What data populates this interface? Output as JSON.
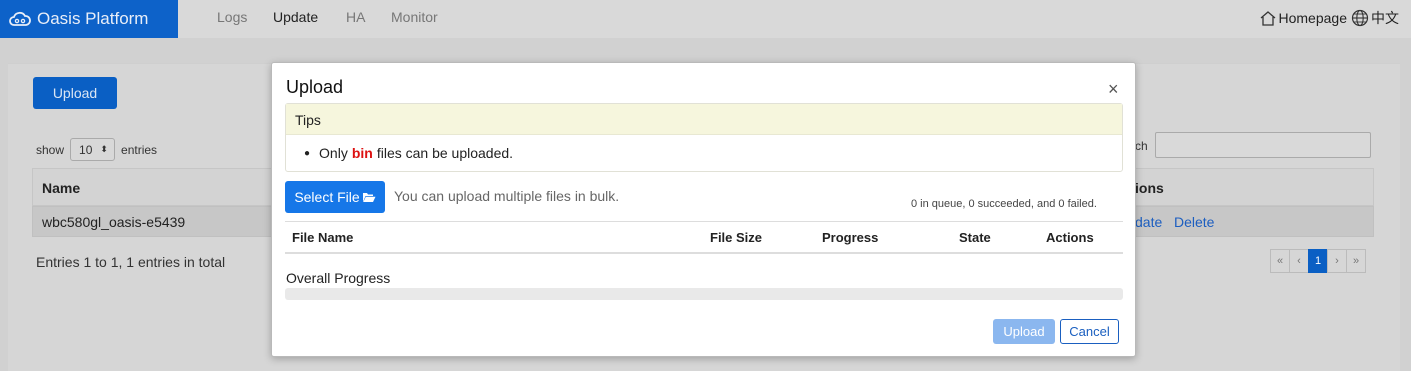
{
  "navbar": {
    "brand": "Oasis Platform",
    "items": [
      "Logs",
      "Update",
      "HA",
      "Monitor"
    ],
    "active_item": "Update",
    "homepage_label": "Homepage",
    "language_label": "中文"
  },
  "page": {
    "upload_button": "Upload",
    "show_label": "show",
    "page_size": "10",
    "entries_label": "entries",
    "search_label_partial": "ch",
    "search_value": "",
    "columns": {
      "name": "Name",
      "actions": "ions"
    },
    "rows": [
      {
        "name": "wbc580gl_oasis-e5439",
        "actions": [
          "date",
          "Delete"
        ]
      }
    ],
    "footer": "Entries 1 to 1, 1 entries in total",
    "pagination": [
      "«",
      "‹",
      "1",
      "›",
      "»"
    ],
    "current_page": "1"
  },
  "modal": {
    "title": "Upload",
    "close_symbol": "×",
    "tips": {
      "heading": "Tips",
      "text_before": "Only",
      "highlight": "bin",
      "text_after": "files can be uploaded."
    },
    "select_file_button": "Select File",
    "hint": "You can upload multiple files in bulk.",
    "queue_status": "0 in queue, 0 succeeded, and 0 failed.",
    "table_columns": [
      "File Name",
      "File Size",
      "Progress",
      "State",
      "Actions"
    ],
    "overall_progress_label": "Overall Progress",
    "overall_progress_value": 0,
    "upload_button": "Upload",
    "cancel_button": "Cancel"
  },
  "colors": {
    "brand": "#0d62c9",
    "primary": "#1677e8",
    "danger": "#dd1111",
    "tips_background": "#f6f6dd"
  },
  "icons": [
    "cloud-icon",
    "home-icon",
    "globe-icon",
    "folder-open-icon",
    "close-icon"
  ]
}
